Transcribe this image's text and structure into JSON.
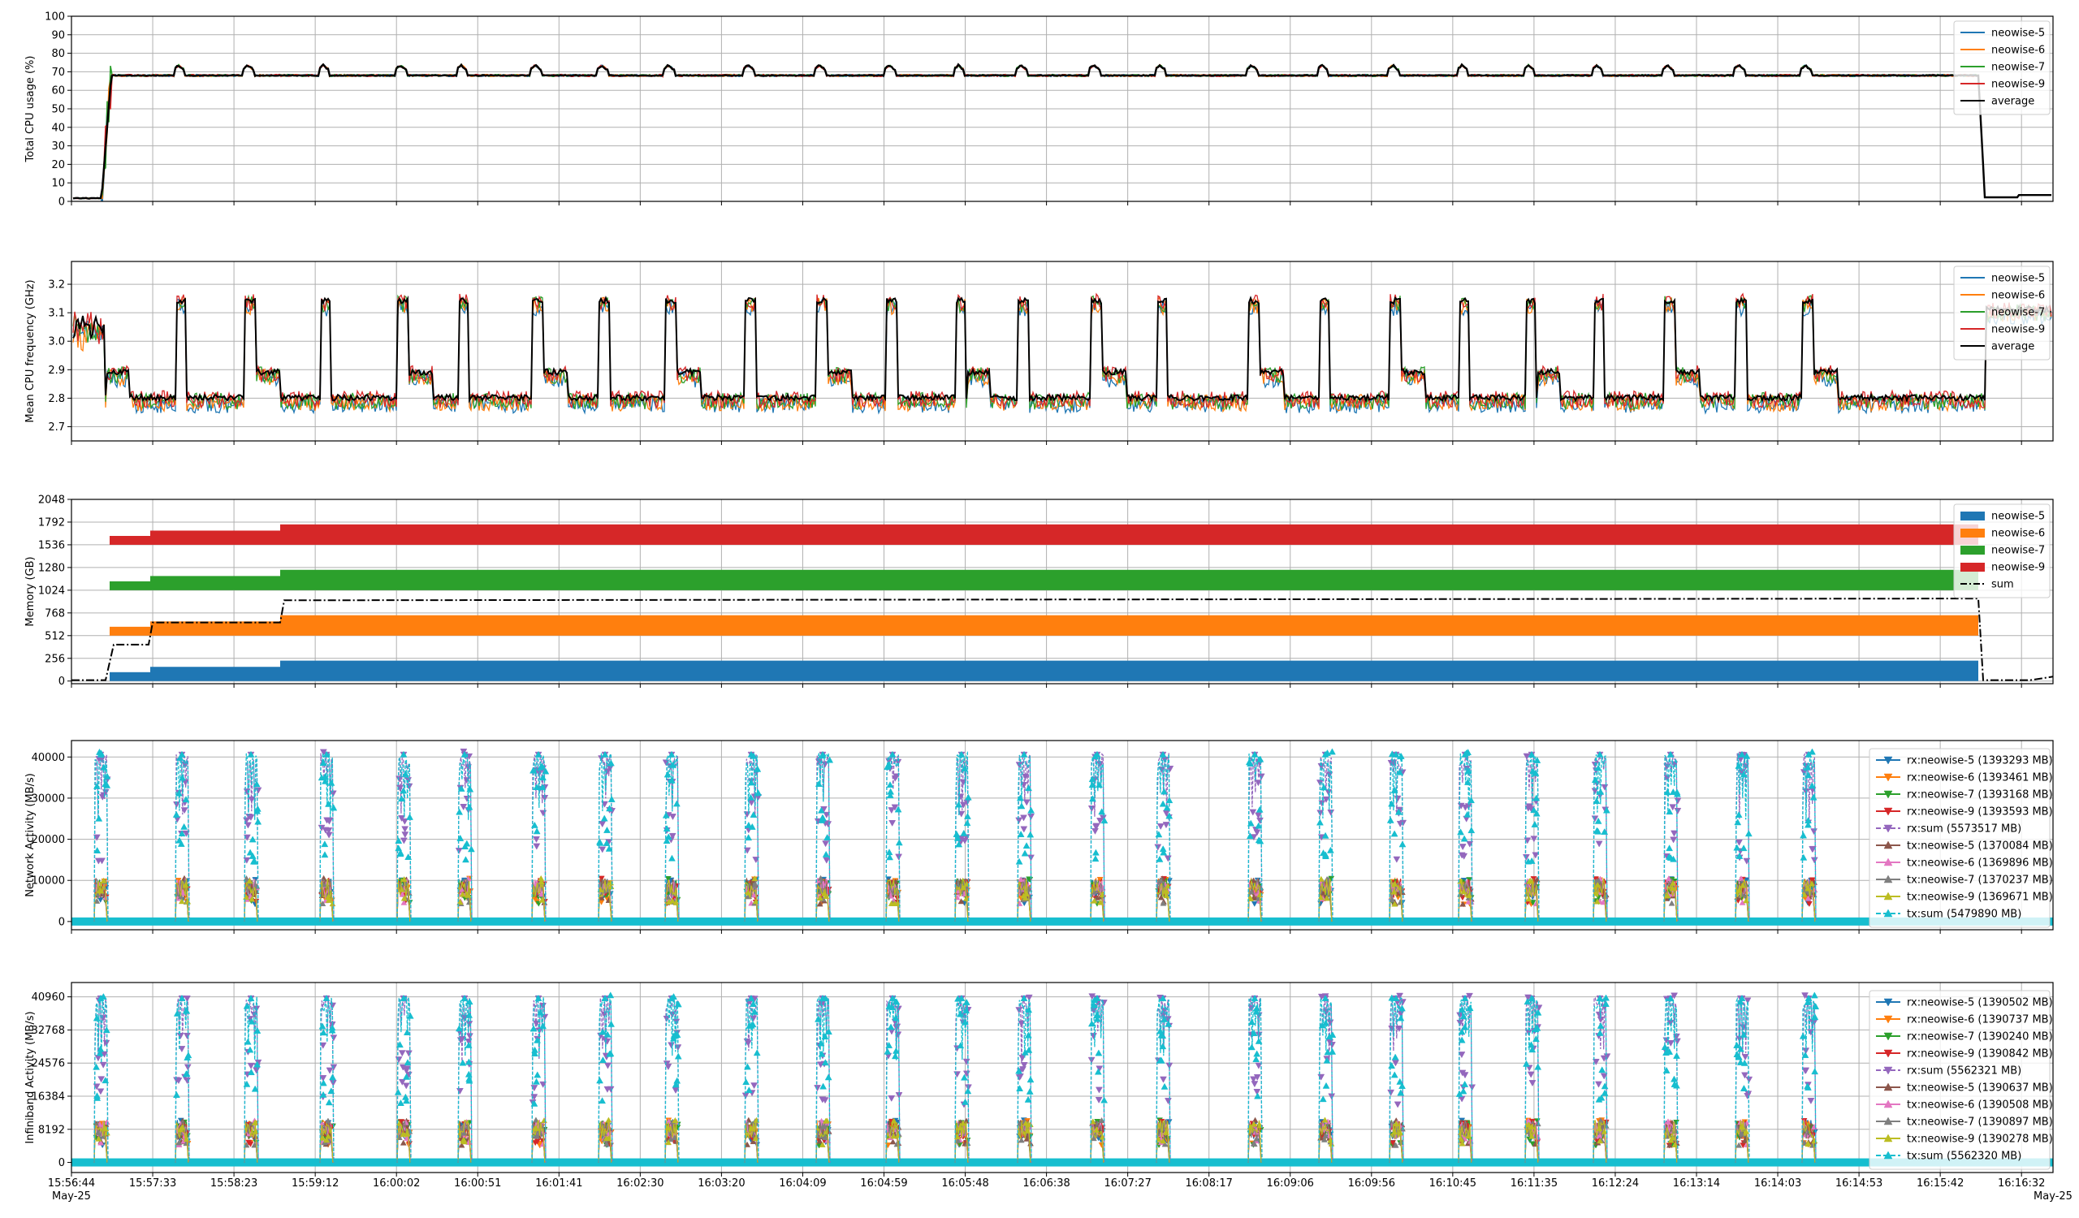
{
  "colors": {
    "neowise-5": "#1f77b4",
    "neowise-6": "#ff7f0e",
    "neowise-7": "#2ca02c",
    "neowise-9": "#d62728",
    "average": "#000000",
    "sum": "#000000",
    "rx_sum": "#9467bd",
    "tx5": "#8c564b",
    "tx6": "#e377c2",
    "tx7": "#7f7f7f",
    "tx9": "#bcbd22",
    "tx_sum": "#17becf"
  },
  "x_axis": {
    "ticks": [
      "15:56:44",
      "15:57:33",
      "15:58:23",
      "15:59:12",
      "16:00:02",
      "16:00:51",
      "16:01:41",
      "16:02:30",
      "16:03:20",
      "16:04:09",
      "16:04:59",
      "16:05:48",
      "16:06:38",
      "16:07:27",
      "16:08:17",
      "16:09:06",
      "16:09:56",
      "16:10:45",
      "16:11:35",
      "16:12:24",
      "16:13:14",
      "16:14:03",
      "16:14:53",
      "16:15:42",
      "16:16:32"
    ],
    "start_date": "May-25",
    "end_date": "May-25"
  },
  "chart_data": [
    {
      "type": "line",
      "ylabel": "Total CPU usage (%)",
      "yticks": [
        "0",
        "10",
        "20",
        "30",
        "40",
        "50",
        "60",
        "70",
        "80",
        "90",
        "100"
      ],
      "ylim": [
        0,
        100
      ],
      "legend": "top-right",
      "grid": true,
      "series": [
        {
          "name": "neowise-5",
          "color_key": "neowise-5"
        },
        {
          "name": "neowise-6",
          "color_key": "neowise-6"
        },
        {
          "name": "neowise-7",
          "color_key": "neowise-7"
        },
        {
          "name": "neowise-9",
          "color_key": "neowise-9"
        },
        {
          "name": "average",
          "color_key": "average"
        }
      ],
      "profile": {
        "idle": 1.5,
        "busy": 68,
        "peak": 73.5,
        "tail": 3
      }
    },
    {
      "type": "line",
      "ylabel": "Mean CPU frequency (GHz)",
      "yticks": [
        "2.7",
        "2.8",
        "2.9",
        "3.0",
        "3.1",
        "3.2"
      ],
      "ylim": [
        2.65,
        3.28
      ],
      "legend": "top-right",
      "grid": true,
      "series": [
        {
          "name": "neowise-5",
          "color_key": "neowise-5"
        },
        {
          "name": "neowise-6",
          "color_key": "neowise-6"
        },
        {
          "name": "neowise-7",
          "color_key": "neowise-7"
        },
        {
          "name": "neowise-9",
          "color_key": "neowise-9"
        },
        {
          "name": "average",
          "color_key": "average"
        }
      ],
      "profile": {
        "low": 2.79,
        "mid": 2.88,
        "high": 3.13,
        "idle": 3.04
      }
    },
    {
      "type": "area",
      "ylabel": "Memory (GB)",
      "yticks": [
        "0",
        "256",
        "512",
        "768",
        "1024",
        "1280",
        "1536",
        "1792",
        "2048"
      ],
      "ylim": [
        -30,
        2048
      ],
      "legend": "top-right",
      "grid": true,
      "stack_bands": [
        {
          "name": "neowise-5",
          "color_key": "neowise-5",
          "base": 0,
          "levels": [
            100,
            160,
            230
          ]
        },
        {
          "name": "neowise-6",
          "color_key": "neowise-6",
          "base": 512,
          "levels": [
            100,
            160,
            230
          ]
        },
        {
          "name": "neowise-7",
          "color_key": "neowise-7",
          "base": 1024,
          "levels": [
            100,
            160,
            230
          ]
        },
        {
          "name": "neowise-9",
          "color_key": "neowise-9",
          "base": 1536,
          "levels": [
            100,
            160,
            230
          ]
        }
      ],
      "sum_series": {
        "name": "sum",
        "color_key": "sum",
        "levels": [
          10,
          410,
          660,
          910,
          930,
          10,
          50
        ]
      }
    },
    {
      "type": "line",
      "ylabel": "Network Activity (MB/s)",
      "yticks": [
        "0",
        "10000",
        "20000",
        "30000",
        "40000"
      ],
      "ylim": [
        -2000,
        44000
      ],
      "legend": "right",
      "grid": true,
      "series": [
        {
          "name": "rx:neowise-5 (1393293 MB)",
          "color_key": "neowise-5",
          "marker": "v",
          "dash": false
        },
        {
          "name": "rx:neowise-6 (1393461 MB)",
          "color_key": "neowise-6",
          "marker": "v",
          "dash": false
        },
        {
          "name": "rx:neowise-7 (1393168 MB)",
          "color_key": "neowise-7",
          "marker": "v",
          "dash": false
        },
        {
          "name": "rx:neowise-9 (1393593 MB)",
          "color_key": "neowise-9",
          "marker": "v",
          "dash": false
        },
        {
          "name": "rx:sum (5573517 MB)",
          "color_key": "rx_sum",
          "marker": "v",
          "dash": true
        },
        {
          "name": "tx:neowise-5 (1370084 MB)",
          "color_key": "tx5",
          "marker": "^",
          "dash": false
        },
        {
          "name": "tx:neowise-6 (1369896 MB)",
          "color_key": "tx6",
          "marker": "^",
          "dash": false
        },
        {
          "name": "tx:neowise-7 (1370237 MB)",
          "color_key": "tx7",
          "marker": "^",
          "dash": false
        },
        {
          "name": "tx:neowise-9 (1369671 MB)",
          "color_key": "tx9",
          "marker": "^",
          "dash": false
        },
        {
          "name": "tx:sum (5479890 MB)",
          "color_key": "tx_sum",
          "marker": "^",
          "dash": true
        }
      ],
      "burst": {
        "sum_peak": 41000,
        "node_peak": 10500
      }
    },
    {
      "type": "line",
      "ylabel": "Infiniband Activity (MB/s)",
      "yticks": [
        "0",
        "8192",
        "16384",
        "24576",
        "32768",
        "40960"
      ],
      "ylim": [
        -2500,
        44500
      ],
      "legend": "right",
      "grid": true,
      "series": [
        {
          "name": "rx:neowise-5 (1390502 MB)",
          "color_key": "neowise-5",
          "marker": "v",
          "dash": false
        },
        {
          "name": "rx:neowise-6 (1390737 MB)",
          "color_key": "neowise-6",
          "marker": "v",
          "dash": false
        },
        {
          "name": "rx:neowise-7 (1390240 MB)",
          "color_key": "neowise-7",
          "marker": "v",
          "dash": false
        },
        {
          "name": "rx:neowise-9 (1390842 MB)",
          "color_key": "neowise-9",
          "marker": "v",
          "dash": false
        },
        {
          "name": "rx:sum (5562321 MB)",
          "color_key": "rx_sum",
          "marker": "v",
          "dash": true
        },
        {
          "name": "tx:neowise-5 (1390637 MB)",
          "color_key": "tx5",
          "marker": "^",
          "dash": false
        },
        {
          "name": "tx:neowise-6 (1390508 MB)",
          "color_key": "tx6",
          "marker": "^",
          "dash": false
        },
        {
          "name": "tx:neowise-7 (1390897 MB)",
          "color_key": "tx7",
          "marker": "^",
          "dash": false
        },
        {
          "name": "tx:neowise-9 (1390278 MB)",
          "color_key": "tx9",
          "marker": "^",
          "dash": false
        },
        {
          "name": "tx:sum (5562320 MB)",
          "color_key": "tx_sum",
          "marker": "^",
          "dash": true
        }
      ],
      "burst": {
        "sum_peak": 41000,
        "node_peak": 10500
      }
    }
  ]
}
